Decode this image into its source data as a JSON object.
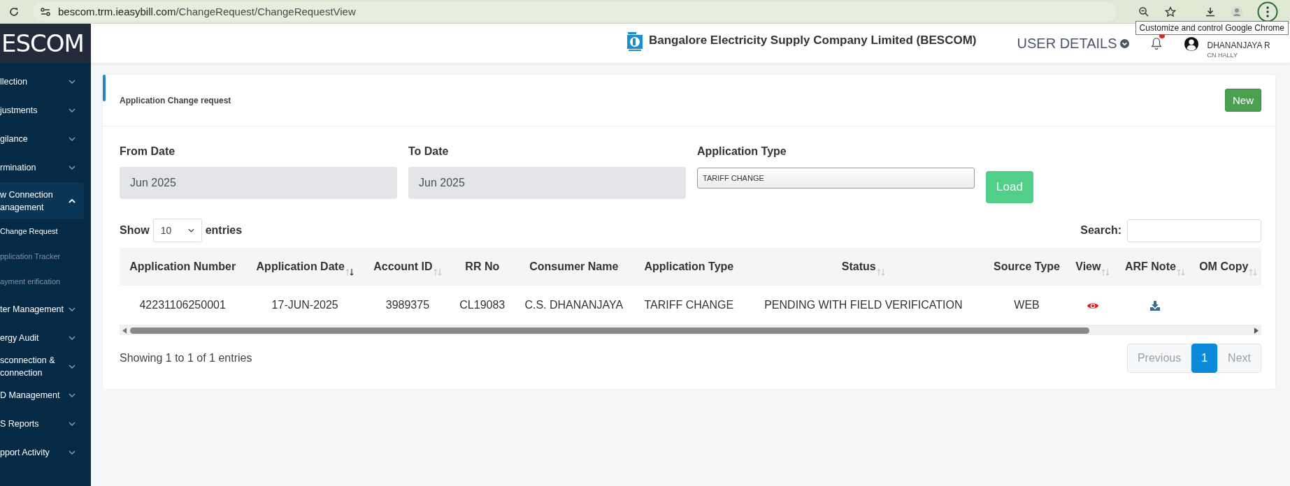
{
  "browser": {
    "url_host": "bescom.trm.ieasybill.com",
    "url_path": "/ChangeRequest/ChangeRequestView",
    "tooltip": "Customize and control Google Chrome"
  },
  "logo_text": "ESCOM",
  "sidebar": {
    "items": [
      {
        "label": "llection",
        "expanded": false
      },
      {
        "label": "justments",
        "expanded": false
      },
      {
        "label": "gilance",
        "expanded": false
      },
      {
        "label": "rmination",
        "expanded": false
      },
      {
        "label": "w Connection anagement",
        "expanded": true,
        "children": [
          {
            "label": "Change Request",
            "selected": true
          },
          {
            "label": "pplication Tracker",
            "selected": false
          },
          {
            "label": "ayment erification",
            "selected": false
          }
        ]
      },
      {
        "label": "ter Management",
        "expanded": false
      },
      {
        "label": "ergy Audit",
        "expanded": false
      },
      {
        "label": "sconnection & connection",
        "expanded": false
      },
      {
        "label": "D Management",
        "expanded": false
      },
      {
        "label": "S Reports",
        "expanded": false
      },
      {
        "label": "pport Activity",
        "expanded": false
      }
    ]
  },
  "header": {
    "company": "Bangalore Electricity Supply Company Limited (BESCOM)",
    "user_menu": "USER DETAILS",
    "user_name": "DHANANJAYA R",
    "user_location": "CN HALLY"
  },
  "card": {
    "title": "Application Change request",
    "new_button": "New",
    "filters": [
      {
        "label": "From Date",
        "value": "Jun 2025",
        "kind": "date"
      },
      {
        "label": "To Date",
        "value": "Jun 2025",
        "kind": "date"
      },
      {
        "label": "Application Type",
        "value": "TARIFF CHANGE",
        "kind": "select"
      }
    ],
    "load_button": "Load",
    "length": {
      "prefix": "Show",
      "value": "10",
      "suffix": "entries"
    },
    "search_label": "Search:",
    "table": {
      "columns": [
        {
          "label": "Application Number"
        },
        {
          "label": "Application Date",
          "sorted": true
        },
        {
          "label": "Account ID",
          "sorted": false
        },
        {
          "label": "RR No"
        },
        {
          "label": "Consumer Name"
        },
        {
          "label": "Application Type"
        },
        {
          "label": "Status",
          "sorted": false
        },
        {
          "label": "Source Type"
        },
        {
          "label": "View",
          "sorted": false
        },
        {
          "label": "ARF Note",
          "sorted": false
        },
        {
          "label": "OM Copy",
          "sorted": false
        }
      ],
      "rows": [
        {
          "cells": [
            {
              "kind": "text",
              "text": "42231106250001"
            },
            {
              "kind": "text",
              "text": "17-JUN-2025"
            },
            {
              "kind": "text",
              "text": "3989375"
            },
            {
              "kind": "text",
              "text": "CL19083"
            },
            {
              "kind": "text",
              "text": "C.S. DHANANJAYA"
            },
            {
              "kind": "text",
              "text": "TARIFF CHANGE"
            },
            {
              "kind": "text",
              "text": "PENDING WITH FIELD VERIFICATION"
            },
            {
              "kind": "text",
              "text": "WEB"
            },
            {
              "kind": "view"
            },
            {
              "kind": "download"
            },
            {
              "kind": "empty"
            }
          ]
        }
      ]
    },
    "info": "Showing 1 to 1 of 1 entries",
    "pagination": [
      {
        "label": "Previous",
        "kind": "nav",
        "disabled": true,
        "selected": false
      },
      {
        "label": "1",
        "kind": "page",
        "disabled": false,
        "selected": true
      },
      {
        "label": "Next",
        "kind": "nav",
        "disabled": true,
        "selected": false
      }
    ]
  }
}
